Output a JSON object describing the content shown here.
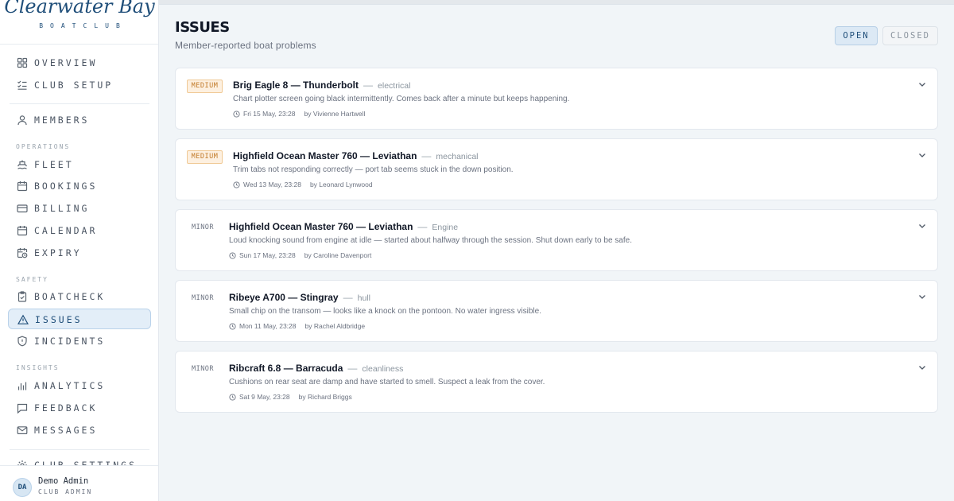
{
  "brand": {
    "name": "Clearwater Bay",
    "sub": "BOATCLUB"
  },
  "sidebar": {
    "items": [
      {
        "label": "OVERVIEW",
        "icon": "grid-icon"
      },
      {
        "label": "CLUB SETUP",
        "icon": "checklist-icon"
      },
      {
        "label": "MEMBERS",
        "icon": "user-icon"
      },
      {
        "label": "FLEET",
        "icon": "boat-icon"
      },
      {
        "label": "BOOKINGS",
        "icon": "calendar-icon"
      },
      {
        "label": "BILLING",
        "icon": "card-icon"
      },
      {
        "label": "CALENDAR",
        "icon": "calendar-icon"
      },
      {
        "label": "EXPIRY",
        "icon": "calendar-clock-icon"
      },
      {
        "label": "BOATCHECK",
        "icon": "clipboard-icon"
      },
      {
        "label": "ISSUES",
        "icon": "warning-icon"
      },
      {
        "label": "INCIDENTS",
        "icon": "shield-icon"
      },
      {
        "label": "ANALYTICS",
        "icon": "bar-chart-icon"
      },
      {
        "label": "FEEDBACK",
        "icon": "message-icon"
      },
      {
        "label": "MESSAGES",
        "icon": "mail-icon"
      },
      {
        "label": "CLUB SETTINGS",
        "icon": "gear-icon"
      }
    ],
    "sections": {
      "operations": "OPERATIONS",
      "safety": "SAFETY",
      "insights": "INSIGHTS"
    },
    "active": "ISSUES"
  },
  "user": {
    "initials": "DA",
    "name": "Demo Admin",
    "role": "CLUB ADMIN"
  },
  "header": {
    "title": "ISSUES",
    "subtitle": "Member-reported boat problems"
  },
  "tabs": {
    "open": "OPEN",
    "closed": "CLOSED",
    "selected": "OPEN"
  },
  "issues": [
    {
      "severity": "MEDIUM",
      "boat": "Brig Eagle 8 — Thunderbolt",
      "category": "electrical",
      "description": "Chart plotter screen going black intermittently. Comes back after a minute but keeps happening.",
      "date": "Fri 15 May, 23:28",
      "reporter": "by Vivienne Hartwell"
    },
    {
      "severity": "MEDIUM",
      "boat": "Highfield Ocean Master 760 — Leviathan",
      "category": "mechanical",
      "description": "Trim tabs not responding correctly — port tab seems stuck in the down position.",
      "date": "Wed 13 May, 23:28",
      "reporter": "by Leonard Lynwood"
    },
    {
      "severity": "MINOR",
      "boat": "Highfield Ocean Master 760 — Leviathan",
      "category": "Engine",
      "description": "Loud knocking sound from engine at idle — started about halfway through the session. Shut down early to be safe.",
      "date": "Sun 17 May, 23:28",
      "reporter": "by Caroline Davenport"
    },
    {
      "severity": "MINOR",
      "boat": "Ribeye A700 — Stingray",
      "category": "hull",
      "description": "Small chip on the transom — looks like a knock on the pontoon. No water ingress visible.",
      "date": "Mon 11 May, 23:28",
      "reporter": "by Rachel Aldbridge"
    },
    {
      "severity": "MINOR",
      "boat": "Ribcraft 6.8 — Barracuda",
      "category": "cleanliness",
      "description": "Cushions on rear seat are damp and have started to smell. Suspect a leak from the cover.",
      "date": "Sat 9 May, 23:28",
      "reporter": "by Richard Briggs"
    }
  ],
  "colors": {
    "accent": "#1f4e79",
    "medium_badge": "#c27b2a",
    "active_bg": "#e3eef8"
  }
}
